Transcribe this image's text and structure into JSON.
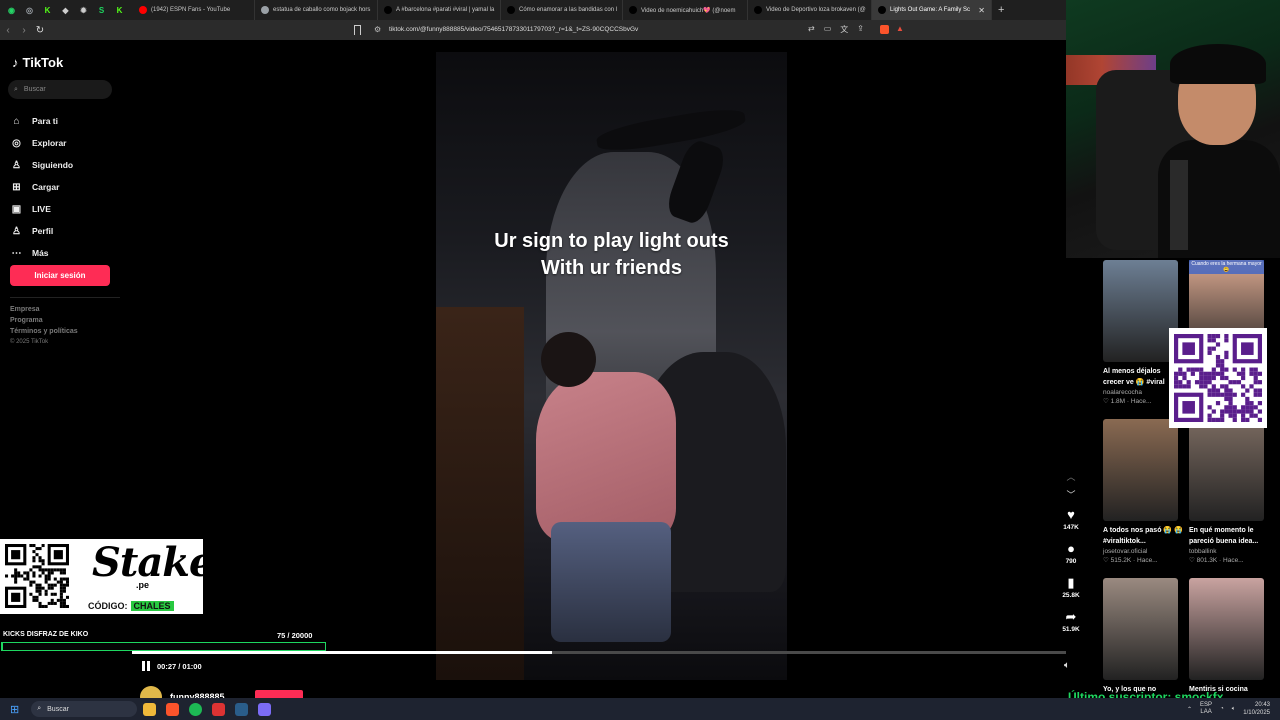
{
  "browser": {
    "pinned_tabs": [
      {
        "icon": "whatsapp-icon",
        "color": "#25d366",
        "glyph": "◉"
      },
      {
        "icon": "chrome-icon",
        "color": "#9aa0a6",
        "glyph": "◎"
      },
      {
        "icon": "kick-icon",
        "color": "#53fc18",
        "glyph": "K"
      },
      {
        "icon": "app-icon",
        "color": "#cccccc",
        "glyph": "◆"
      },
      {
        "icon": "settings-icon",
        "color": "#cccccc",
        "glyph": "✹"
      },
      {
        "icon": "stake-icon",
        "color": "#1ed760",
        "glyph": "S"
      },
      {
        "icon": "kick-icon",
        "color": "#53fc18",
        "glyph": "K"
      }
    ],
    "tabs": [
      {
        "label": "(1942) ESPN Fans - YouTube",
        "fav": "#ff0000",
        "width": 122
      },
      {
        "label": "estatua de caballo como bojack hors",
        "fav": "#9aa0a6",
        "width": 123
      },
      {
        "label": "A #barcelona #parati #viral | yamal la",
        "fav": "#000000",
        "width": 123
      },
      {
        "label": "Cómo enamorar a las bandidas con l",
        "fav": "#000000",
        "width": 122
      },
      {
        "label": "Video de noemicahuich💖 (@noem",
        "fav": "#000000",
        "width": 125
      },
      {
        "label": "Video de Deportivo loza brokaven (@",
        "fav": "#000000",
        "width": 124
      },
      {
        "label": "Lights Out Game: A Family Sc",
        "fav": "#000000",
        "width": 120,
        "active": true
      }
    ],
    "new_tab": "+",
    "url": "tiktok.com/@funny888885/video/7546517873301179703?_r=1&_t=ZS-90CQCCSbvGv"
  },
  "tiktok": {
    "logo": "TikTok",
    "search_placeholder": "Buscar",
    "menu": [
      {
        "label": "Para ti",
        "icon": "home-icon",
        "glyph": "⌂"
      },
      {
        "label": "Explorar",
        "icon": "compass-icon",
        "glyph": "◎"
      },
      {
        "label": "Siguiendo",
        "icon": "following-icon",
        "glyph": "♙"
      },
      {
        "label": "Cargar",
        "icon": "upload-icon",
        "glyph": "⊞"
      },
      {
        "label": "LIVE",
        "icon": "live-icon",
        "glyph": "▣"
      },
      {
        "label": "Perfil",
        "icon": "profile-icon",
        "glyph": "♙"
      },
      {
        "label": "Más",
        "icon": "more-icon",
        "glyph": "⋯"
      }
    ],
    "login_button": "Iniciar sesión",
    "footer": [
      "Empresa",
      "Programa",
      "Términos y políticas"
    ],
    "copyright": "© 2025 TikTok"
  },
  "video": {
    "caption_line1": "Ur sign to play light outs",
    "caption_line2": "With ur friends",
    "current_time": "00:27",
    "duration": "01:00",
    "time_display": "00:27 / 01:00",
    "progress": 0.45,
    "author": "funny888885"
  },
  "actions": [
    {
      "name": "like",
      "icon": "heart-icon",
      "glyph": "♥",
      "count": "147K"
    },
    {
      "name": "comment",
      "icon": "comment-icon",
      "glyph": "●",
      "count": "790"
    },
    {
      "name": "save",
      "icon": "bookmark-icon",
      "glyph": "▮",
      "count": "25.8K"
    },
    {
      "name": "share",
      "icon": "share-icon",
      "glyph": "➦",
      "count": "51.9K"
    }
  ],
  "related": [
    {
      "title": "Al menos déjalos crecer ve 😭 #viral",
      "user": "noalarecocha",
      "stats": "♡ 1.8M · Hace...",
      "color": "#6d7f94"
    },
    {
      "title": "",
      "user": "",
      "stats": "",
      "color": "#d9a78f",
      "badge": "Cuando eres la hermana mayor 😩"
    },
    {
      "title": "A todos nos pasó 😭 😭 #viraltiktok...",
      "user": "josetovar.oficial",
      "stats": "♡ 515.2K · Hace...",
      "color": "#8a6a52"
    },
    {
      "title": "En qué momento le pareció buena idea...",
      "user": "tobballink",
      "stats": "♡ 801.3K · Hace...",
      "color": "#7a6a60"
    },
    {
      "title": "Yo, y los que no",
      "user": "",
      "stats": "",
      "color": "#9a8a80"
    },
    {
      "title": "Mentiris si cocina",
      "user": "",
      "stats": "",
      "color": "#c9a3a0"
    }
  ],
  "overlays": {
    "stake_logo": "Stake",
    "stake_domain": ".pe",
    "stake_code_label": "CÓDIGO:",
    "stake_code": "CHALES",
    "goal_title": "KICKS DISFRAZ DE KIKO",
    "goal_count": "75  / 20000",
    "goal_progress": 0.00375,
    "subscriber_alert": "Último suscriptor: smockfx"
  },
  "taskbar": {
    "search": "Buscar",
    "lang_line1": "ESP",
    "lang_line2": "LAA",
    "time": "20:43",
    "date": "1/10/2025"
  }
}
